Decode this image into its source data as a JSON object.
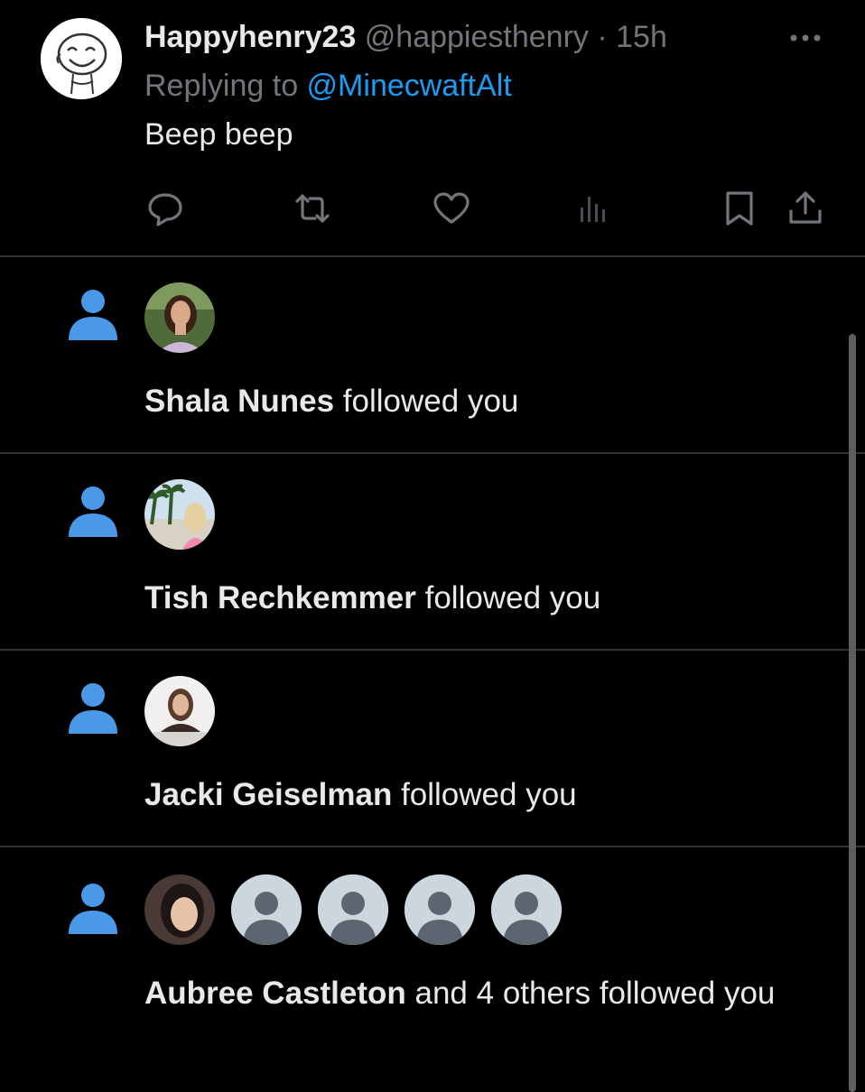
{
  "tweet": {
    "name": "Happyhenry23",
    "handle": "@happiesthenry",
    "dot": "·",
    "time": "15h",
    "replying_prefix": "Replying to ",
    "replying_to": "@MinecwaftAlt",
    "text": "Beep beep",
    "icons": [
      "reply-icon",
      "retweet-icon",
      "like-icon",
      "views-icon",
      "bookmark-icon",
      "share-icon",
      "more-icon"
    ]
  },
  "notifications": [
    {
      "name": "Shala Nunes",
      "suffix": " followed you"
    },
    {
      "name": "Tish Rechkemmer",
      "suffix": " followed you"
    },
    {
      "name": "Jacki Geiselman",
      "suffix": " followed you"
    },
    {
      "name": "Aubree Castleton",
      "suffix": " and 4 others followed you"
    }
  ],
  "colors": {
    "background": "#000000",
    "text": "#e7e9ea",
    "secondary": "#71767b",
    "accent": "#1d9bf0",
    "follow_icon": "#4a99e9",
    "divider": "#2f3336",
    "default_avatar": "#ccd6dd"
  }
}
